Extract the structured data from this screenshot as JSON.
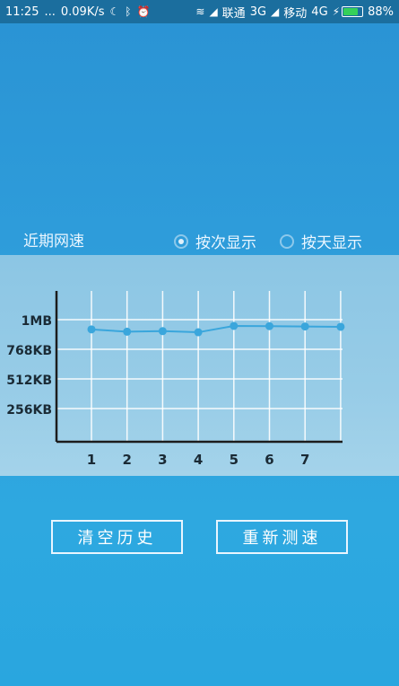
{
  "status_bar": {
    "time": "11:25",
    "dots": "...",
    "speed": "0.09K/s",
    "carrier1": "联通",
    "net1": "3G",
    "carrier2": "移动",
    "net2": "4G",
    "battery": "88%",
    "battery_level": 0.88
  },
  "recent": {
    "title": "近期网速",
    "options": [
      {
        "label": "按次显示",
        "selected": true
      },
      {
        "label": "按天显示",
        "selected": false
      }
    ]
  },
  "chart_data": {
    "type": "line",
    "x": [
      1,
      2,
      3,
      4,
      5,
      6,
      7,
      8
    ],
    "x_tick_labels": [
      "1",
      "2",
      "3",
      "4",
      "5",
      "6",
      "7"
    ],
    "y_tick_labels": [
      "1MB",
      "768KB",
      "512KB",
      "256KB"
    ],
    "y_tick_values": [
      1024,
      768,
      512,
      256
    ],
    "ylim": [
      0,
      1024
    ],
    "series": [
      {
        "values": [
          940,
          920,
          925,
          915,
          970,
          968,
          965,
          962
        ]
      }
    ],
    "grid": true
  },
  "buttons": {
    "clear": "清空历史",
    "retest": "重新测速"
  }
}
